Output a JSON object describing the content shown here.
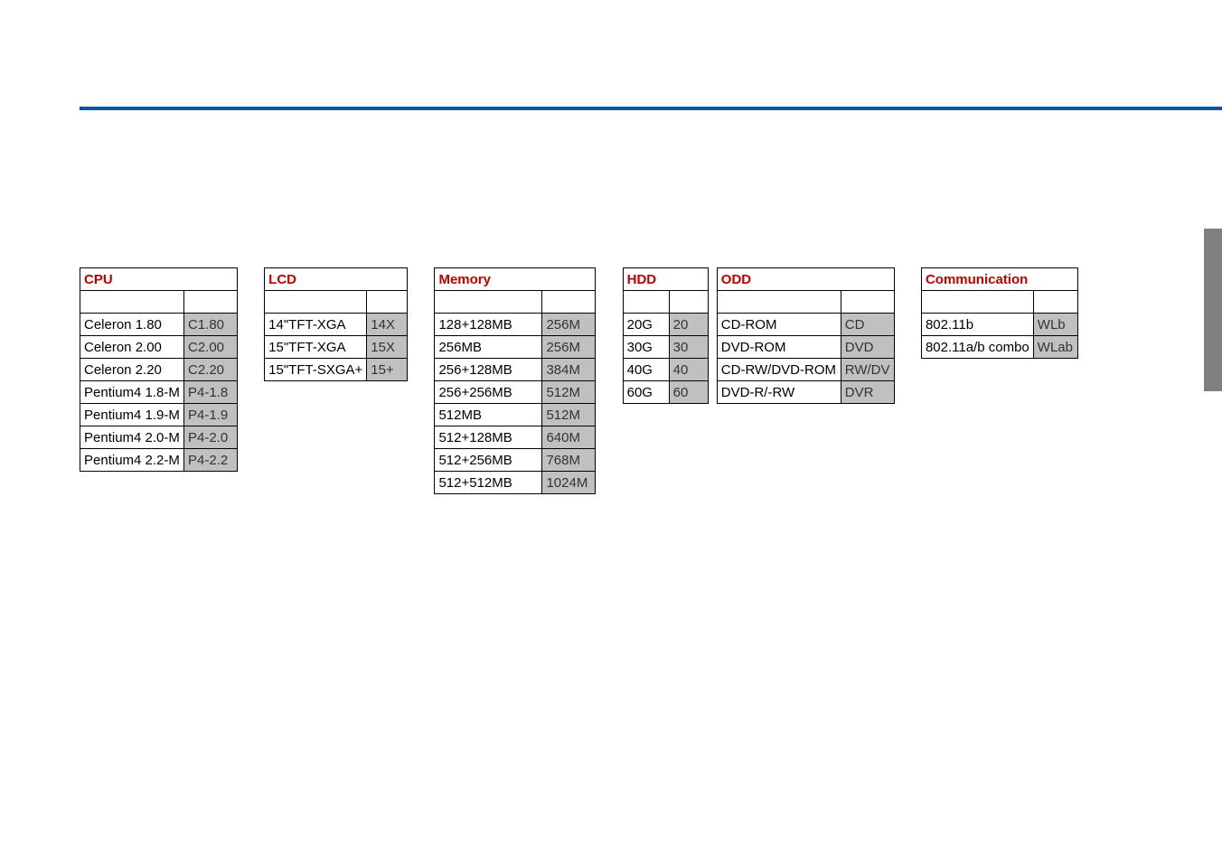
{
  "cpu": {
    "header": "CPU",
    "rows": [
      {
        "label": "Celeron 1.80",
        "code": "C1.80"
      },
      {
        "label": "Celeron 2.00",
        "code": "C2.00"
      },
      {
        "label": "Celeron 2.20",
        "code": "C2.20"
      },
      {
        "label": "Pentium4 1.8-M",
        "code": "P4-1.8"
      },
      {
        "label": "Pentium4 1.9-M",
        "code": "P4-1.9"
      },
      {
        "label": "Pentium4 2.0-M",
        "code": "P4-2.0"
      },
      {
        "label": "Pentium4 2.2-M",
        "code": "P4-2.2"
      }
    ]
  },
  "lcd": {
    "header": "LCD",
    "rows": [
      {
        "label": "14\"TFT-XGA",
        "code": "14X"
      },
      {
        "label": "15\"TFT-XGA",
        "code": "15X"
      },
      {
        "label": "15\"TFT-SXGA+",
        "code": "15+"
      }
    ]
  },
  "memory": {
    "header": "Memory",
    "rows": [
      {
        "label": "128+128MB",
        "code": "256M"
      },
      {
        "label": "256MB",
        "code": "256M"
      },
      {
        "label": "256+128MB",
        "code": "384M"
      },
      {
        "label": "256+256MB",
        "code": "512M"
      },
      {
        "label": "512MB",
        "code": "512M"
      },
      {
        "label": "512+128MB",
        "code": "640M"
      },
      {
        "label": "512+256MB",
        "code": "768M"
      },
      {
        "label": "512+512MB",
        "code": "1024M"
      }
    ]
  },
  "hdd": {
    "header": "HDD",
    "rows": [
      {
        "label": "20G",
        "code": "20"
      },
      {
        "label": "30G",
        "code": "30"
      },
      {
        "label": "40G",
        "code": "40"
      },
      {
        "label": "60G",
        "code": "60"
      }
    ]
  },
  "odd": {
    "header": "ODD",
    "rows": [
      {
        "label": "CD-ROM",
        "code": "CD"
      },
      {
        "label": "DVD-ROM",
        "code": "DVD"
      },
      {
        "label": "CD-RW/DVD-ROM",
        "code": "RW/DV"
      },
      {
        "label": "DVD-R/-RW",
        "code": "DVR"
      }
    ]
  },
  "comm": {
    "header": "Communication",
    "rows": [
      {
        "label": "802.11b",
        "code": "WLb"
      },
      {
        "label": "802.11a/b combo",
        "code": "WLab"
      }
    ]
  }
}
